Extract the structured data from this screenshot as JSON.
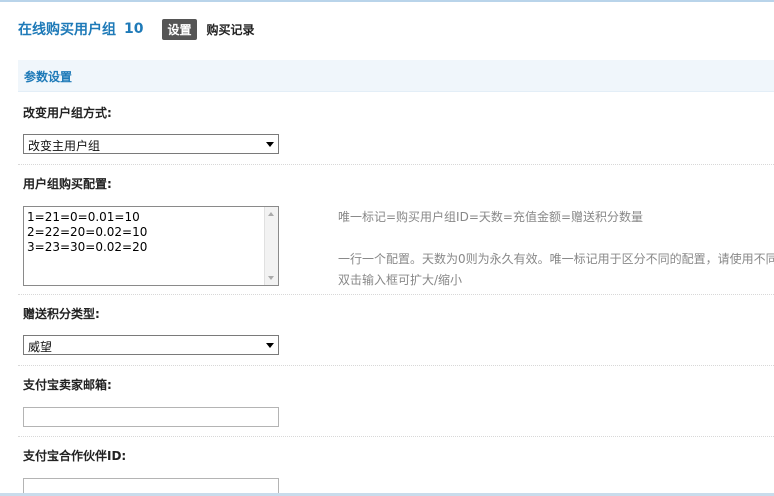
{
  "header": {
    "title": "在线购买用户组",
    "count": "10",
    "tab_settings": "设置",
    "tab_records": "购买记录"
  },
  "section": {
    "title": "参数设置"
  },
  "fields": {
    "change_mode": {
      "label": "改变用户组方式:",
      "value": "改变主用户组"
    },
    "purchase_config": {
      "label": "用户组购买配置:",
      "lines": [
        "1=21=0=0.01=10",
        "2=22=20=0.02=10",
        "3=23=30=0.02=20"
      ],
      "hint_format": "唯一标记=购买用户组ID=天数=充值金额=赠送积分数量",
      "hint_desc": "一行一个配置。天数为0则为永久有效。唯一标记用于区分不同的配置，请使用不同",
      "hint_resize": "双击输入框可扩大/缩小"
    },
    "credit_type": {
      "label": "赠送积分类型:",
      "value": "威望"
    },
    "alipay_email": {
      "label": "支付宝卖家邮箱:",
      "value": ""
    },
    "alipay_partner": {
      "label": "支付宝合作伙伴ID:",
      "value": ""
    }
  }
}
